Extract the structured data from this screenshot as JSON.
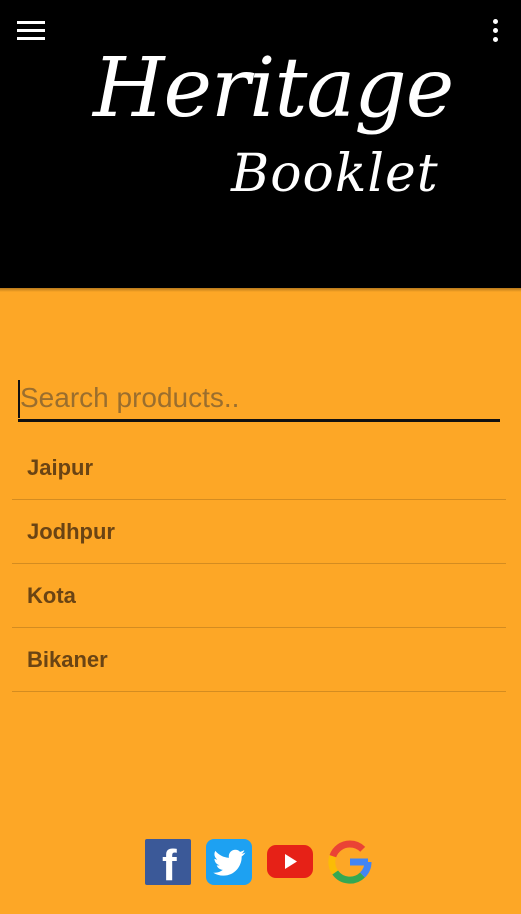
{
  "header": {
    "menu_icon": "hamburger-menu-icon",
    "overflow_icon": "more-vertical-icon",
    "logo_line1": "Heritage",
    "logo_line2": "Booklet"
  },
  "search": {
    "placeholder": "Search products..",
    "value": ""
  },
  "results": [
    {
      "label": "Jaipur"
    },
    {
      "label": "Jodhpur"
    },
    {
      "label": "Kota"
    },
    {
      "label": "Bikaner"
    }
  ],
  "social": [
    {
      "name": "facebook",
      "icon": "facebook-icon",
      "color": "#3b5998"
    },
    {
      "name": "twitter",
      "icon": "twitter-icon",
      "color": "#1da1f2"
    },
    {
      "name": "youtube",
      "icon": "youtube-icon",
      "color": "#e62117"
    },
    {
      "name": "google",
      "icon": "google-icon",
      "color": "#4285f4"
    }
  ],
  "colors": {
    "header_background": "#000000",
    "page_background": "#FDA726",
    "list_text": "#6a4414"
  }
}
